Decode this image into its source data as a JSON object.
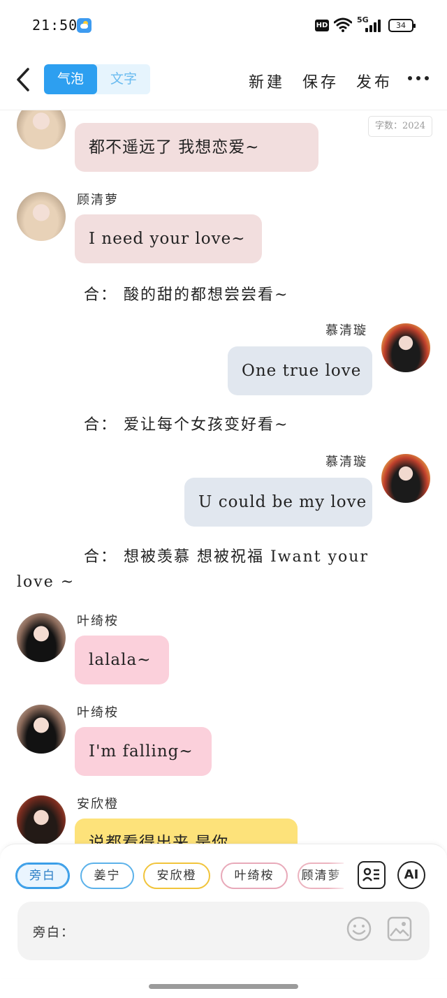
{
  "status_bar": {
    "time": "21:50",
    "hd_badge": "HD",
    "network": "5G",
    "battery": "34"
  },
  "header": {
    "tab_bubble": "气泡",
    "tab_text": "文字",
    "new_label": "新建",
    "save_label": "保存",
    "publish_label": "发布"
  },
  "chat": {
    "word_count": "字数：2024",
    "messages": [
      {
        "sender": "",
        "text": "都不遥远了 我想恋爱~"
      },
      {
        "sender": "顾清萝",
        "text": "I need your love~"
      },
      {
        "narration": "合：  酸的甜的都想尝尝看~"
      },
      {
        "sender": "慕清璇",
        "text": "One true love"
      },
      {
        "narration": "合：  爱让每个女孩变好看~"
      },
      {
        "sender": "慕清璇",
        "text": "U could be my love"
      },
      {
        "narration_line1": "合：  想被羡慕 想被祝福 Iwant your",
        "narration_line2": "love ~"
      },
      {
        "sender": "叶绮桉",
        "text": "lalala~"
      },
      {
        "sender": "叶绮桉",
        "text": "I'm falling~"
      },
      {
        "sender": "安欣橙",
        "text": "说都看得出来 是你"
      }
    ]
  },
  "composer": {
    "chips": [
      "旁白",
      "姜宁",
      "安欣橙",
      "叶绮桉",
      "顾清萝"
    ],
    "ai_label": "AI",
    "input_placeholder": "旁白："
  }
}
